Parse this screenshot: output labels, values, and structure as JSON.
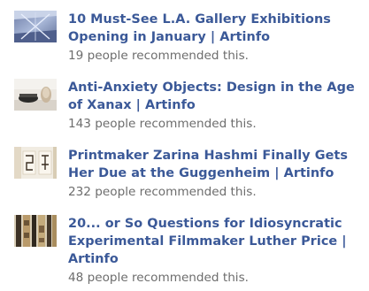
{
  "recommendations": [
    {
      "title": "10 Must-See L.A. Gallery Exhibitions Opening in January | Artinfo",
      "recommended_text": "19 people recommended this.",
      "thumbnail_icon": "gallery-light-installation-thumbnail"
    },
    {
      "title": "Anti-Anxiety Objects: Design in the Age of Xanax | Artinfo",
      "recommended_text": "143 people recommended this.",
      "thumbnail_icon": "design-objects-thumbnail"
    },
    {
      "title": "Printmaker Zarina Hashmi Finally Gets Her Due at the Guggenheim | Artinfo",
      "recommended_text": "232 people recommended this.",
      "thumbnail_icon": "prints-thumbnail"
    },
    {
      "title": "20... or So Questions for Idiosyncratic Experimental Filmmaker Luther Price | Artinfo",
      "recommended_text": "48 people recommended this.",
      "thumbnail_icon": "film-strip-thumbnail"
    }
  ],
  "colors": {
    "link": "#3b5998",
    "meta_text": "#6d6d6d",
    "background": "#ffffff"
  }
}
